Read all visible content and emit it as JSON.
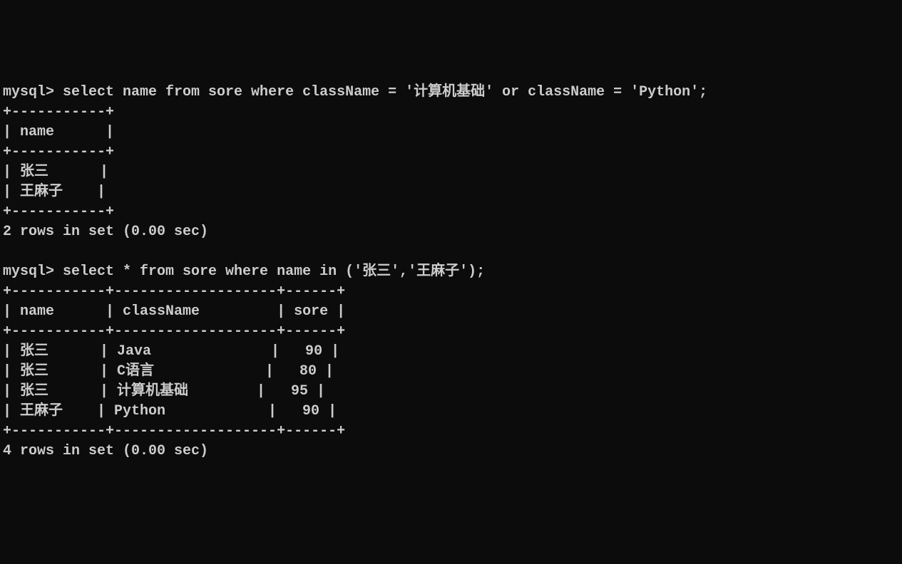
{
  "query1": {
    "prompt": "mysql> ",
    "sql": "select name from sore where className = '计算机基础' or className = 'Python';",
    "border_top": "+-----------+",
    "header_row": "| name      |",
    "border_mid": "+-----------+",
    "rows": [
      "| 张三      |",
      "| 王麻子    |"
    ],
    "border_bot": "+-----------+",
    "summary": "2 rows in set (0.00 sec)"
  },
  "query2": {
    "prompt": "mysql> ",
    "sql": "select * from sore where name in ('张三','王麻子');",
    "border_top": "+-----------+-------------------+------+",
    "header_row": "| name      | className         | sore |",
    "border_mid": "+-----------+-------------------+------+",
    "rows": [
      "| 张三      | Java              |   90 |",
      "| 张三      | C语言             |   80 |",
      "| 张三      | 计算机基础        |   95 |",
      "| 王麻子    | Python            |   90 |"
    ],
    "border_bot": "+-----------+-------------------+------+",
    "summary": "4 rows in set (0.00 sec)"
  }
}
